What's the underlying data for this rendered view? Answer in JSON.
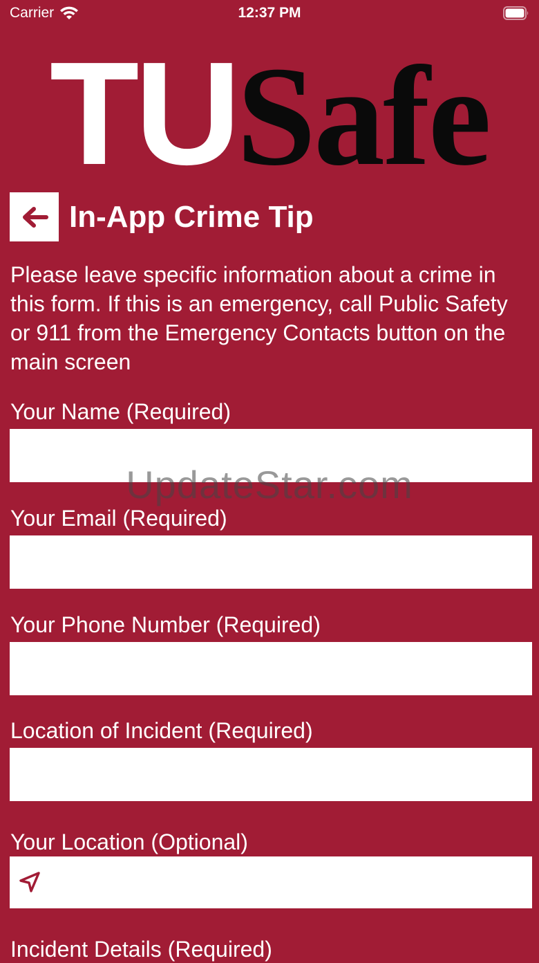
{
  "status_bar": {
    "carrier": "Carrier",
    "time": "12:37 PM"
  },
  "logo": {
    "part_1": "TU",
    "part_2": "Safe"
  },
  "header": {
    "title": "In-App Crime Tip",
    "back_icon": "arrow-left-icon"
  },
  "intro_text": "Please leave specific information about a crime in this form. If this is an emergency, call Public Safety or 911 from the Emergency Contacts button on the main screen",
  "form": {
    "fields": [
      {
        "label": "Your Name (Required)",
        "value": ""
      },
      {
        "label": "Your Email (Required)",
        "value": ""
      },
      {
        "label": "Your Phone Number (Required)",
        "value": ""
      },
      {
        "label": "Location of Incident (Required)",
        "value": ""
      },
      {
        "label": "Your Location (Optional)",
        "value": "",
        "icon": "location-arrow-icon"
      },
      {
        "label": "Incident Details (Required)"
      }
    ]
  },
  "watermark": "UpdateStar.com",
  "colors": {
    "background": "#a11c35",
    "accent": "#a11c35",
    "field_background": "#ffffff"
  }
}
